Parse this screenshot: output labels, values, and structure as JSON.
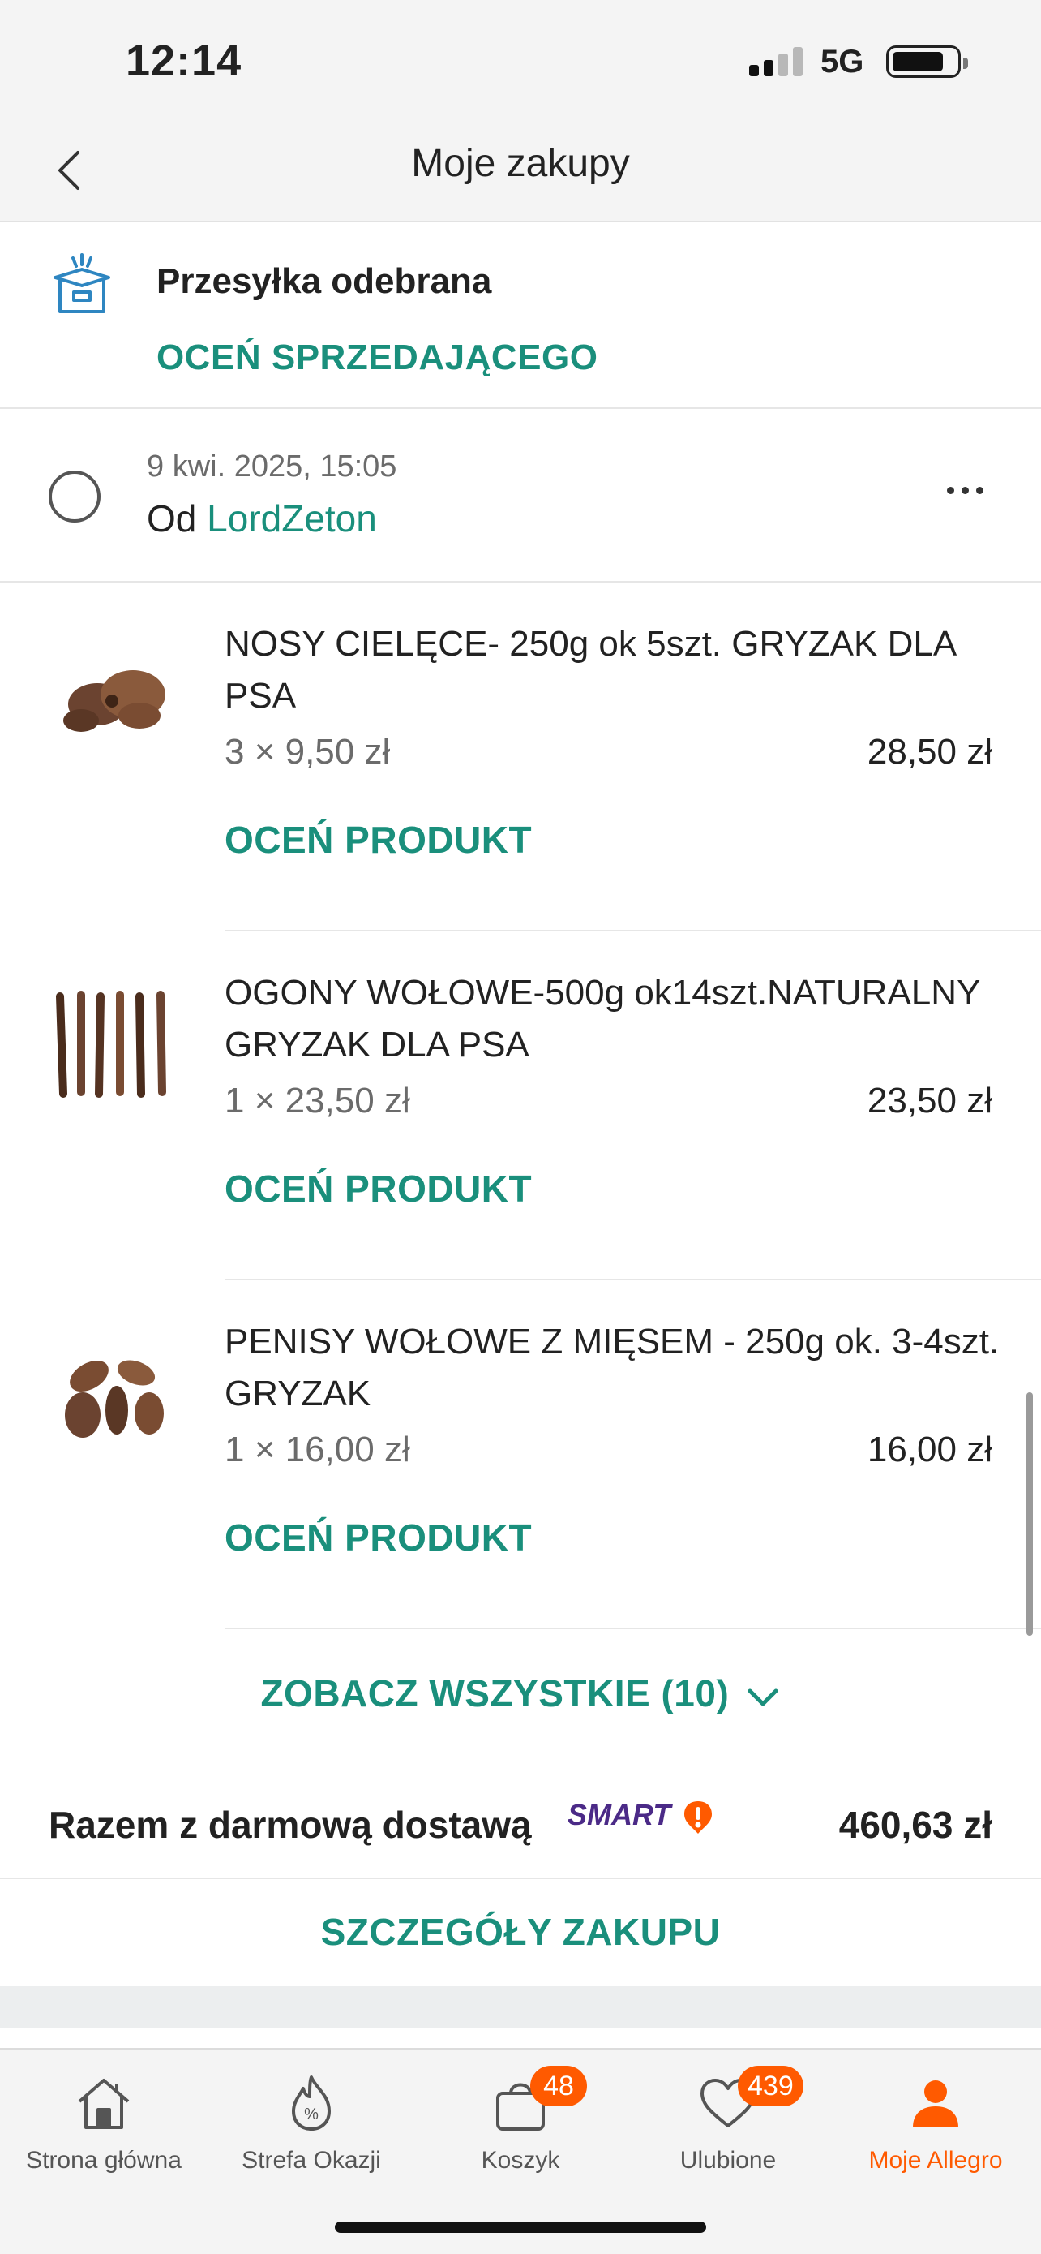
{
  "status_bar": {
    "time": "12:14",
    "network": "5G"
  },
  "header": {
    "title": "Moje zakupy"
  },
  "shipment": {
    "status": "Przesyłka odebrana",
    "rate_seller_label": "OCEŃ SPRZEDAJĄCEGO"
  },
  "order": {
    "date": "9 kwi. 2025, 15:05",
    "seller_prefix": "Od",
    "seller_name": "LordZeton"
  },
  "products": [
    {
      "name": "NOSY CIELĘCE- 250g ok 5szt. GRYZAK DLA PSA",
      "quantity_price": "3 × 9,50 zł",
      "total": "28,50 zł",
      "rate_label": "OCEŃ PRODUKT"
    },
    {
      "name": "OGONY WOŁOWE-500g ok14szt.NATURALNY GRYZAK DLA PSA",
      "quantity_price": "1 × 23,50 zł",
      "total": "23,50 zł",
      "rate_label": "OCEŃ PRODUKT"
    },
    {
      "name": "PENISY WOŁOWE Z MIĘSEM - 250g ok. 3-4szt. GRYZAK",
      "quantity_price": "1 × 16,00 zł",
      "total": "16,00 zł",
      "rate_label": "OCEŃ PRODUKT"
    }
  ],
  "see_all_label": "ZOBACZ WSZYSTKIE (10)",
  "summary": {
    "label": "Razem z darmową dostawą",
    "smart_badge": "SMART",
    "amount": "460,63 zł"
  },
  "details_label": "SZCZEGÓŁY ZAKUPU",
  "tabs": [
    {
      "label": "Strona główna",
      "icon": "home-icon"
    },
    {
      "label": "Strefa Okazji",
      "icon": "deals-flame-icon"
    },
    {
      "label": "Koszyk",
      "icon": "cart-bag-icon",
      "badge": "48"
    },
    {
      "label": "Ulubione",
      "icon": "heart-icon",
      "badge": "439"
    },
    {
      "label": "Moje Allegro",
      "icon": "user-icon",
      "active": true
    }
  ],
  "colors": {
    "accent_teal": "#1a8f7c",
    "accent_orange": "#ff5a00",
    "smart_purple": "#4b2a87"
  }
}
